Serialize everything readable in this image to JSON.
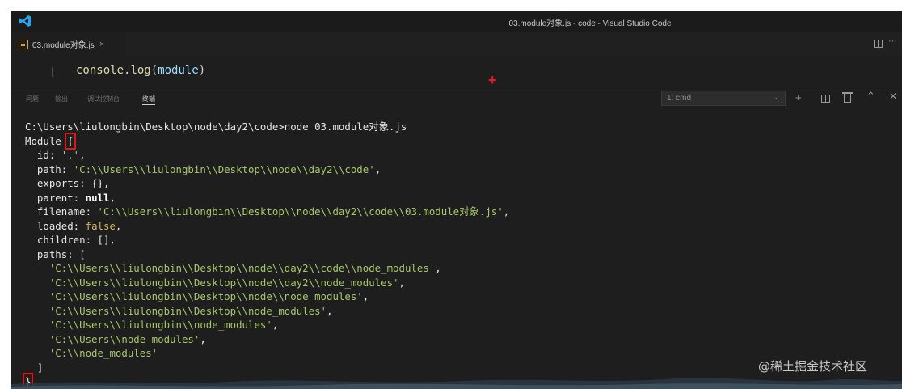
{
  "window": {
    "title": "03.module对象.js - code - Visual Studio Code"
  },
  "tab": {
    "label": "03.module对象.js",
    "close": "×"
  },
  "editor": {
    "code_obj": "console",
    "code_dot": ".",
    "code_fn": "log",
    "code_open": "(",
    "code_arg": "module",
    "code_close": ")"
  },
  "panel": {
    "tabs": [
      "问题",
      "输出",
      "调试控制台",
      "终端"
    ],
    "active_tab": "终端",
    "terminal_select": "1: cmd"
  },
  "terminal": {
    "command": "C:\\Users\\liulongbin\\Desktop\\node\\day2\\code>node 03.module对象.js",
    "module_label": "Module ",
    "open_brace": "{",
    "id_key": "  id: ",
    "id_val": "'.'",
    "path_key": "  path: ",
    "path_val": "'C:\\\\Users\\\\liulongbin\\\\Desktop\\\\node\\\\day2\\\\code'",
    "exports_line": "  exports: {},",
    "parent_key": "  parent: ",
    "parent_val": "null",
    "filename_key": "  filename: ",
    "filename_val": "'C:\\\\Users\\\\liulongbin\\\\Desktop\\\\node\\\\day2\\\\code\\\\03.module对象.js'",
    "loaded_key": "  loaded: ",
    "loaded_val": "false",
    "children_line": "  children: [],",
    "paths_key": "  paths: [",
    "paths": [
      "'C:\\\\Users\\\\liulongbin\\\\Desktop\\\\node\\\\day2\\\\code\\\\node_modules'",
      "'C:\\\\Users\\\\liulongbin\\\\Desktop\\\\node\\\\day2\\\\node_modules'",
      "'C:\\\\Users\\\\liulongbin\\\\Desktop\\\\node\\\\node_modules'",
      "'C:\\\\Users\\\\liulongbin\\\\Desktop\\\\node_modules'",
      "'C:\\\\Users\\\\liulongbin\\\\node_modules'",
      "'C:\\\\Users\\\\node_modules'",
      "'C:\\\\node_modules'"
    ],
    "paths_close": "  ]",
    "close_brace": "}"
  },
  "watermark": "@稀土掘金技术社区",
  "colors": {
    "background": "#1e1e1e",
    "string": "#a6c76a",
    "highlight_box": "#e0161b",
    "vscode_blue": "#23a9f2"
  },
  "icons": [
    "vscode-logo-icon",
    "file-js-icon",
    "close-icon",
    "split-editor-icon",
    "more-actions-icon",
    "chevron-down-icon",
    "add-terminal-icon",
    "split-terminal-icon",
    "trash-icon",
    "chevron-up-icon",
    "close-panel-icon"
  ]
}
